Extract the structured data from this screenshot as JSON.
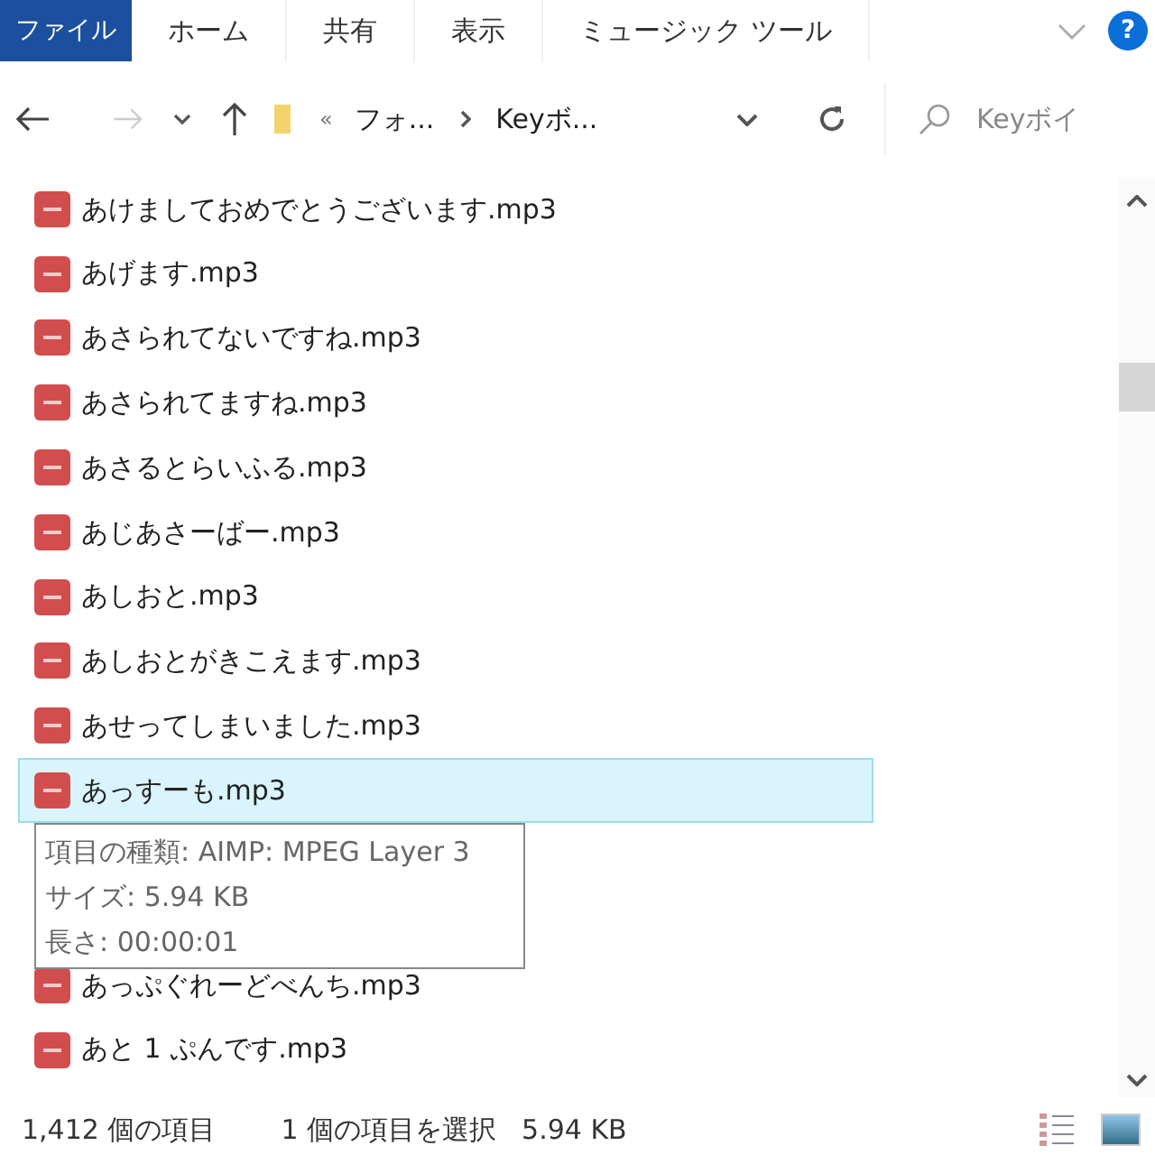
{
  "ribbon": {
    "tabs": [
      {
        "label": "ファイル",
        "selected": true
      },
      {
        "label": "ホーム",
        "selected": false
      },
      {
        "label": "共有",
        "selected": false
      },
      {
        "label": "表示",
        "selected": false
      },
      {
        "label": "ミュージック ツール",
        "selected": false
      }
    ],
    "help": "?"
  },
  "address": {
    "overflow": "«",
    "crumbs": [
      "フォ...",
      "Keyボ..."
    ]
  },
  "search": {
    "placeholder": "Keyボイ"
  },
  "files": [
    {
      "name": "あけましておめでとうございます.mp3",
      "selected": false
    },
    {
      "name": "あげます.mp3",
      "selected": false
    },
    {
      "name": "あさられてないですね.mp3",
      "selected": false
    },
    {
      "name": "あさられてますね.mp3",
      "selected": false
    },
    {
      "name": "あさるとらいふる.mp3",
      "selected": false
    },
    {
      "name": "あじあさーばー.mp3",
      "selected": false
    },
    {
      "name": "あしおと.mp3",
      "selected": false
    },
    {
      "name": "あしおとがきこえます.mp3",
      "selected": false
    },
    {
      "name": "あせってしまいました.mp3",
      "selected": false
    },
    {
      "name": "あっすーも.mp3",
      "selected": true
    },
    {
      "name": "あっぷぐれーどべんち.mp3",
      "selected": false
    },
    {
      "name": "あと 1 ぷんです.mp3",
      "selected": false
    }
  ],
  "tooltip": [
    "項目の種類: AIMP: MPEG Layer 3",
    "サイズ: 5.94 KB",
    "長さ: 00:00:01"
  ],
  "status_bar": {
    "count": "1,412 個の項目",
    "selection": "1 個の項目を選択",
    "size": "5.94 KB"
  }
}
